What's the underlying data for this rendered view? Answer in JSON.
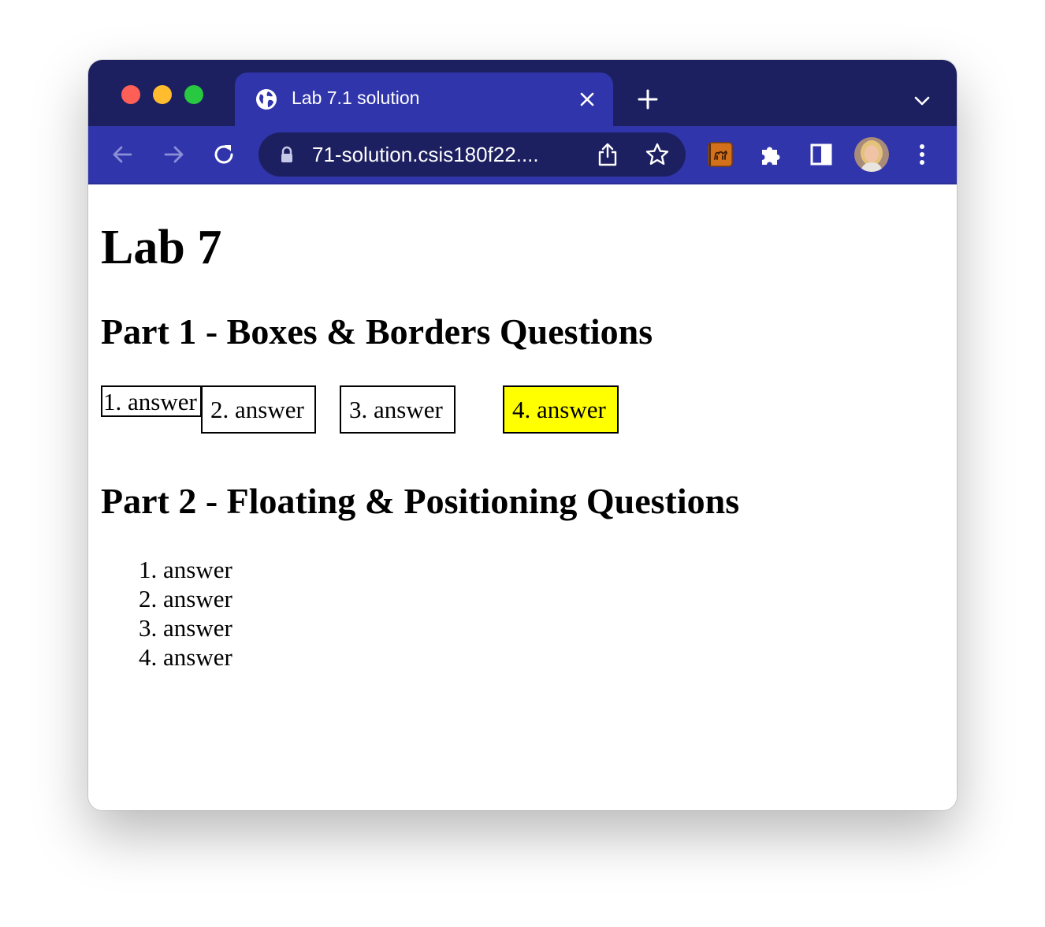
{
  "browser": {
    "tab": {
      "title": "Lab 7.1 solution"
    },
    "address": {
      "url": "71-solution.csis180f22...."
    },
    "colors": {
      "tabstrip": "#1d2060",
      "toolbar": "#3035ab",
      "omnibox": "#1d2060"
    },
    "icons": {
      "favicon": "globe-icon",
      "close": "close-icon",
      "new_tab": "plus-icon",
      "tab_menu": "chevron-down-icon",
      "back": "back-arrow-icon",
      "forward": "forward-arrow-icon",
      "reload": "reload-icon",
      "lock": "lock-icon",
      "share": "share-icon",
      "bookmark": "star-icon",
      "extension_app": "camel-extension-icon",
      "extensions": "puzzle-icon",
      "side_panel": "side-panel-icon",
      "profile": "avatar",
      "menu": "kebab-menu-icon"
    }
  },
  "page": {
    "heading": "Lab 7",
    "part1": {
      "heading": "Part 1 - Boxes & Borders Questions",
      "boxes": [
        "1. answer",
        "2. answer",
        "3. answer",
        "4. answer"
      ],
      "highlight_color": "#ffff00"
    },
    "part2": {
      "heading": "Part 2 - Floating & Positioning Questions",
      "items": [
        "1. answer",
        "2. answer",
        "3. answer",
        "4. answer"
      ]
    }
  }
}
